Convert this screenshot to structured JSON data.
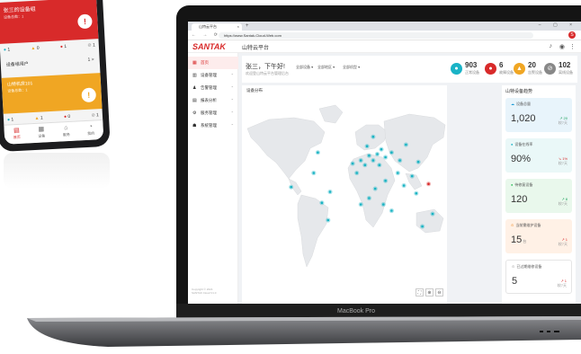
{
  "phone": {
    "alarm_card": {
      "title": "张三的设备组",
      "subtitle": "设备总数：1",
      "badge": "!"
    },
    "stats": [
      {
        "icon": "●",
        "value": "1",
        "color": "#1ab3c6"
      },
      {
        "icon": "▲",
        "value": "0",
        "color": "#f0a623"
      },
      {
        "icon": "●",
        "value": "1",
        "color": "#d82a2a"
      },
      {
        "icon": "⊘",
        "value": "1",
        "color": "#888888"
      }
    ],
    "group_row": {
      "label": "设备组用户",
      "count": "1",
      "chevron": ">"
    },
    "warn_card": {
      "title": "山特机房101",
      "subtitle": "设备总数：1",
      "badge": "!"
    },
    "stats2": [
      {
        "icon": "●",
        "value": "1",
        "color": "#1ab3c6"
      },
      {
        "icon": "▲",
        "value": "1",
        "color": "#f0a623"
      },
      {
        "icon": "●",
        "value": "0",
        "color": "#d82a2a"
      },
      {
        "icon": "⊘",
        "value": "1",
        "color": "#888888"
      }
    ],
    "tabs": [
      {
        "icon": "▤",
        "label": "首页"
      },
      {
        "icon": "▦",
        "label": "设备"
      },
      {
        "icon": "⌂",
        "label": "服务"
      },
      {
        "icon": "◔",
        "label": "我的"
      }
    ]
  },
  "browser": {
    "tab_title": "山特云平台",
    "tab_close": "×",
    "new_tab": "+",
    "window_controls": "– ▢ ×",
    "nav_buttons": "← → ⟳",
    "url": "https://www.Santak-Cloud-Web.com",
    "profile_initial": "S"
  },
  "app": {
    "logo": "SANTAK",
    "title": "山特云平台",
    "header_icons": [
      "bell",
      "user",
      "more"
    ]
  },
  "sidebar": {
    "items": [
      {
        "icon": "▦",
        "label": "首页",
        "active": true
      },
      {
        "icon": "▥",
        "label": "设备管理"
      },
      {
        "icon": "♟",
        "label": "告警管理"
      },
      {
        "icon": "▤",
        "label": "报表分析"
      },
      {
        "icon": "⚙",
        "label": "服务管理"
      },
      {
        "icon": "☗",
        "label": "系统管理"
      }
    ],
    "footer": [
      "Copyright © 2024",
      "SANTAK Cloud V1.0"
    ]
  },
  "greeting": {
    "title": "张三，下午好!",
    "subtitle": "欢迎登山特云平台管理后台",
    "filters": [
      "全部设备 ▾",
      "全部地区 ▾",
      "全部机型 ▾"
    ]
  },
  "kpis": [
    {
      "value": "903",
      "label": "正常设备",
      "icon": "●",
      "color": "#1ab3c6"
    },
    {
      "value": "6",
      "label": "故障设备",
      "icon": "●",
      "color": "#d82a2a"
    },
    {
      "value": "20",
      "label": "告警设备",
      "icon": "▲",
      "color": "#f0a623"
    },
    {
      "value": "102",
      "label": "离线设备",
      "icon": "⊘",
      "color": "#888888"
    }
  ],
  "map": {
    "title": "设备分布",
    "controls": [
      "⛶",
      "⊕",
      "⊖"
    ],
    "points_ok": [
      [
        0.37,
        0.37
      ],
      [
        0.35,
        0.5
      ],
      [
        0.24,
        0.59
      ],
      [
        0.43,
        0.62
      ],
      [
        0.42,
        0.8
      ],
      [
        0.39,
        0.69
      ],
      [
        0.64,
        0.27
      ],
      [
        0.61,
        0.33
      ],
      [
        0.62,
        0.39
      ],
      [
        0.64,
        0.42
      ],
      [
        0.66,
        0.38
      ],
      [
        0.68,
        0.35
      ],
      [
        0.7,
        0.4
      ],
      [
        0.67,
        0.45
      ],
      [
        0.6,
        0.45
      ],
      [
        0.58,
        0.42
      ],
      [
        0.73,
        0.37
      ],
      [
        0.77,
        0.42
      ],
      [
        0.8,
        0.32
      ],
      [
        0.86,
        0.43
      ],
      [
        0.83,
        0.52
      ],
      [
        0.79,
        0.58
      ],
      [
        0.76,
        0.5
      ],
      [
        0.7,
        0.55
      ],
      [
        0.65,
        0.6
      ],
      [
        0.62,
        0.66
      ],
      [
        0.69,
        0.7
      ],
      [
        0.73,
        0.74
      ],
      [
        0.58,
        0.7
      ],
      [
        0.85,
        0.63
      ],
      [
        0.93,
        0.76
      ],
      [
        0.88,
        0.84
      ],
      [
        0.54,
        0.44
      ],
      [
        0.56,
        0.5
      ]
    ],
    "points_alarm": [
      [
        0.91,
        0.57
      ]
    ]
  },
  "right_panel": {
    "title": "山特设备趋势",
    "cards": [
      {
        "label": "设备总量",
        "icon": "☁",
        "value": "1,020",
        "unit": "",
        "trend": "↗ 20",
        "trend_sub": "较7天",
        "bg": "#e8f4fb",
        "color": "#1a9ad6",
        "trend_color": "#1aa05a"
      },
      {
        "label": "设备在线率",
        "icon": "●",
        "value": "90%",
        "unit": "",
        "trend": "↘ 1%",
        "trend_sub": "较7天",
        "bg": "#eaf8f8",
        "color": "#1ab3c6",
        "trend_color": "#d82a2a"
      },
      {
        "label": "待修复设备",
        "icon": "●",
        "value": "120",
        "unit": "",
        "trend": "↗ 8",
        "trend_sub": "较7天",
        "bg": "#e9f8ec",
        "color": "#2dbd5a",
        "trend_color": "#1aa05a"
      },
      {
        "label": "当前需维护设备",
        "icon": "⊙",
        "value": "15",
        "unit": "台",
        "trend": "↗ 1",
        "trend_sub": "较7天",
        "bg": "#fff1e6",
        "color": "#f08a23",
        "trend_color": "#d82a2a"
      },
      {
        "label": "已过期维修设备",
        "icon": "⊙",
        "value": "5",
        "unit": "",
        "trend": "↗ 1",
        "trend_sub": "较7天",
        "bg": "#ffffff",
        "color": "#999999",
        "trend_color": "#d82a2a"
      }
    ]
  },
  "laptop_label": "MacBook Pro"
}
